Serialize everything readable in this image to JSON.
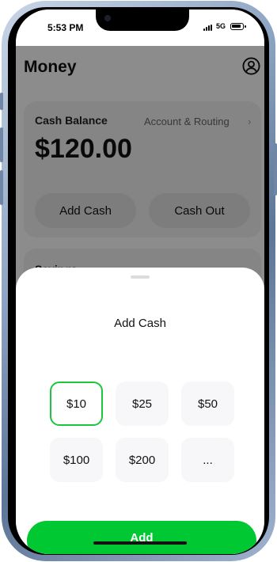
{
  "status_bar": {
    "time": "5:53 PM",
    "network": "5G"
  },
  "app": {
    "title": "Money",
    "cash_balance_label": "Cash Balance",
    "account_routing_label": "Account & Routing",
    "balance": "$120.00",
    "add_cash_label": "Add Cash",
    "cash_out_label": "Cash Out",
    "savings_label": "Savings"
  },
  "sheet": {
    "title": "Add Cash",
    "amounts": [
      "$10",
      "$25",
      "$50",
      "$100",
      "$200",
      "..."
    ],
    "selected": "$10",
    "add_button_label": "Add"
  },
  "colors": {
    "accent": "#00c832",
    "selected_border": "#1dc43e"
  }
}
